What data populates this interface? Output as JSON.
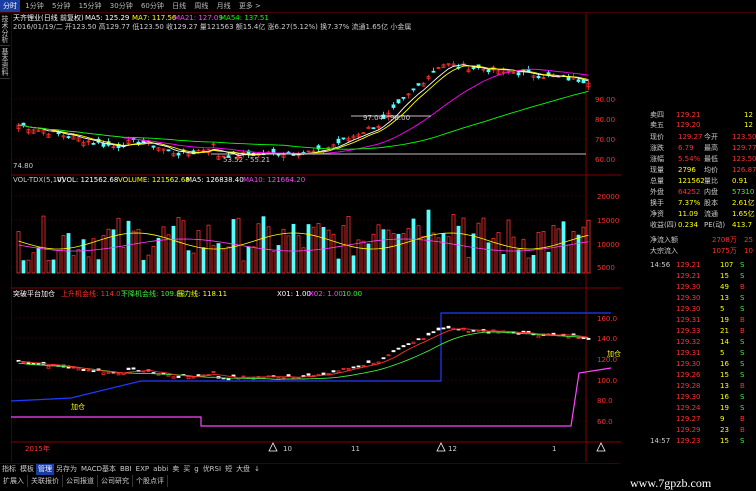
{
  "topbar": {
    "tabs": [
      {
        "label": "分时",
        "active": true
      },
      {
        "label": "1分钟"
      },
      {
        "label": "5分钟"
      },
      {
        "label": "15分钟"
      },
      {
        "label": "30分钟"
      },
      {
        "label": "60分钟"
      },
      {
        "label": "日线"
      },
      {
        "label": "周线"
      },
      {
        "label": "月线"
      },
      {
        "label": "更多 >"
      }
    ]
  },
  "lefttabs": [
    "技术分析",
    "基本资料"
  ],
  "price_panel": {
    "title": "天齐锂业(日线 前复权)",
    "ma5": "MA5: 125.29",
    "ma7": "MA7: 117.56",
    "ma21": "MA21: 127.09",
    "ma54": "MA54: 137.51",
    "info_line": "2016/01/19/二 开123.50 高129.77 低123.50 收129.27 量121563 额15.4亿 涨6.27(5.12%) 换7.37% 流通1.65亿 小金属",
    "low_label": "53.52 - 55.21",
    "box_label": "97.04 - 98.00",
    "left_marker": "74.80"
  },
  "vol_panel": {
    "label": "VOL-TDX(5,10)",
    "vvol": "VVOL: 121562.68",
    "volume": "VOLUME: 121562.68",
    "ma5": "MA5: 126838.40",
    "ma10": "MA10: 121664.20"
  },
  "ind_panel": {
    "title": "突破平台加仓",
    "up": "上升机会线: 114.03",
    "down": "下降机会线: 109.88",
    "press": "压力线: 118.11",
    "x1": "X01: 1.00",
    "x2": "X02: 1.00",
    "x3": "10.00",
    "marker_text": "加仓"
  },
  "x_axis": [
    "2015年",
    "10",
    "11",
    "12",
    "1"
  ],
  "bottom_tabs": [
    {
      "label": "指标"
    },
    {
      "label": "模板"
    },
    {
      "label": "管理",
      "active": true
    },
    {
      "label": "另存为"
    },
    {
      "label": "MACD基本"
    },
    {
      "label": "BBI"
    },
    {
      "label": "EXP"
    },
    {
      "label": "abbi"
    },
    {
      "label": "卖"
    },
    {
      "label": "买"
    },
    {
      "label": "g"
    },
    {
      "label": "优RSI"
    },
    {
      "label": "短"
    },
    {
      "label": "大盘"
    },
    {
      "label": "↓"
    }
  ],
  "bottom_links": [
    "扩展入",
    "关联报价",
    "公司报道",
    "公司研究",
    "个股点评"
  ],
  "watermark": "www.7gpzb.com",
  "quote": {
    "ask_rows": [
      {
        "label": "卖四",
        "price": "129.21",
        "vol": "12"
      },
      {
        "label": "卖五",
        "price": "129.20",
        "vol": "12"
      }
    ],
    "rows": [
      {
        "l1": "现价",
        "v1": "129.27",
        "l2": "今开",
        "v2": "123.50"
      },
      {
        "l1": "涨跌",
        "v1": "6.79",
        "l2": "最高",
        "v2": "129.77"
      },
      {
        "l1": "涨幅",
        "v1": "5.54%",
        "l2": "最低",
        "v2": "123.50"
      },
      {
        "l1": "现量",
        "v1": "2796",
        "l2": "均价",
        "v2": "126.87"
      },
      {
        "l1": "总量",
        "v1": "121562",
        "l2": "量比",
        "v2": "0.91"
      },
      {
        "l1": "外盘",
        "v1": "64252",
        "l2": "内盘",
        "v2": "57310"
      },
      {
        "l1": "换手",
        "v1": "7.37%",
        "l2": "股本",
        "v2": "2.61亿"
      },
      {
        "l1": "净资",
        "v1": "11.09",
        "l2": "流通",
        "v2": "1.65亿"
      },
      {
        "l1": "收益(四)",
        "v1": "0.234",
        "l2": "PE(动)",
        "v2": "413.7"
      }
    ],
    "flow": [
      {
        "label": "净流入额",
        "value": "2708万",
        "flag": "25"
      },
      {
        "label": "大宗流入",
        "value": "1075万",
        "flag": "10"
      }
    ],
    "ticks": [
      {
        "t": "14:56",
        "p": "129.21",
        "v": "107",
        "s": "S"
      },
      {
        "t": "",
        "p": "129.21",
        "v": "15",
        "s": "S"
      },
      {
        "t": "",
        "p": "129.30",
        "v": "49",
        "s": "B"
      },
      {
        "t": "",
        "p": "129.30",
        "v": "13",
        "s": "S"
      },
      {
        "t": "",
        "p": "129.30",
        "v": "5",
        "s": "S"
      },
      {
        "t": "",
        "p": "129.31",
        "v": "19",
        "s": "B"
      },
      {
        "t": "",
        "p": "129.33",
        "v": "21",
        "s": "B"
      },
      {
        "t": "",
        "p": "129.32",
        "v": "14",
        "s": "S"
      },
      {
        "t": "",
        "p": "129.31",
        "v": "5",
        "s": "S"
      },
      {
        "t": "",
        "p": "129.30",
        "v": "16",
        "s": "S"
      },
      {
        "t": "",
        "p": "129.26",
        "v": "15",
        "s": "S"
      },
      {
        "t": "",
        "p": "129.28",
        "v": "13",
        "s": "B"
      },
      {
        "t": "",
        "p": "129.30",
        "v": "16",
        "s": "S"
      },
      {
        "t": "",
        "p": "129.24",
        "v": "19",
        "s": "S"
      },
      {
        "t": "",
        "p": "129.27",
        "v": "9",
        "s": "B"
      },
      {
        "t": "",
        "p": "129.29",
        "v": "23",
        "s": "B"
      },
      {
        "t": "14:57",
        "p": "129.23",
        "v": "15",
        "s": "S"
      }
    ]
  },
  "chart_data": {
    "type": "candlestick",
    "y_axis_price": [
      "60.00",
      "70.00",
      "80.00",
      "90.00"
    ],
    "y_axis_vol": [
      "20000",
      "15000",
      "10000",
      "5000"
    ],
    "y_axis_ind": [
      "160.0",
      "140.0",
      "120.0",
      "100.0",
      "80.0",
      "60.0"
    ],
    "ma_colors": {
      "ma5": "#ffffff",
      "ma7": "#ffff00",
      "ma21": "#ff00ff",
      "ma54": "#00ff00"
    },
    "up_color": "#ff3030",
    "down_color": "#54ffff"
  }
}
